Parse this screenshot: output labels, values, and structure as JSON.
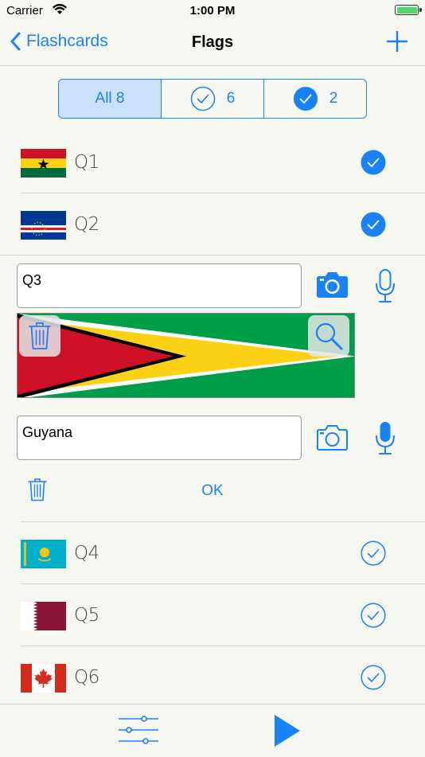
{
  "status_bar": {
    "carrier": "Carrier",
    "time": "1:00 PM"
  },
  "nav": {
    "back_label": "Flashcards",
    "title": "Flags"
  },
  "segments": [
    {
      "label": "All 8"
    },
    {
      "label": "6",
      "icon": "check-outline-icon"
    },
    {
      "label": "2",
      "icon": "check-filled-icon"
    }
  ],
  "cards": [
    {
      "label": "Q1",
      "flag": "ghana",
      "checked": true
    },
    {
      "label": "Q2",
      "flag": "cape-verde",
      "checked": true
    },
    {
      "label": "Q4",
      "flag": "kazakhstan",
      "checked": false
    },
    {
      "label": "Q5",
      "flag": "qatar",
      "checked": false
    },
    {
      "label": "Q6",
      "flag": "canada",
      "checked": false
    }
  ],
  "editor": {
    "question_value": "Q3",
    "answer_value": "Guyana",
    "image_flag": "guyana",
    "ok_label": "OK"
  },
  "colors": {
    "accent": "#1a82f7",
    "background": "#f7f7f2"
  }
}
